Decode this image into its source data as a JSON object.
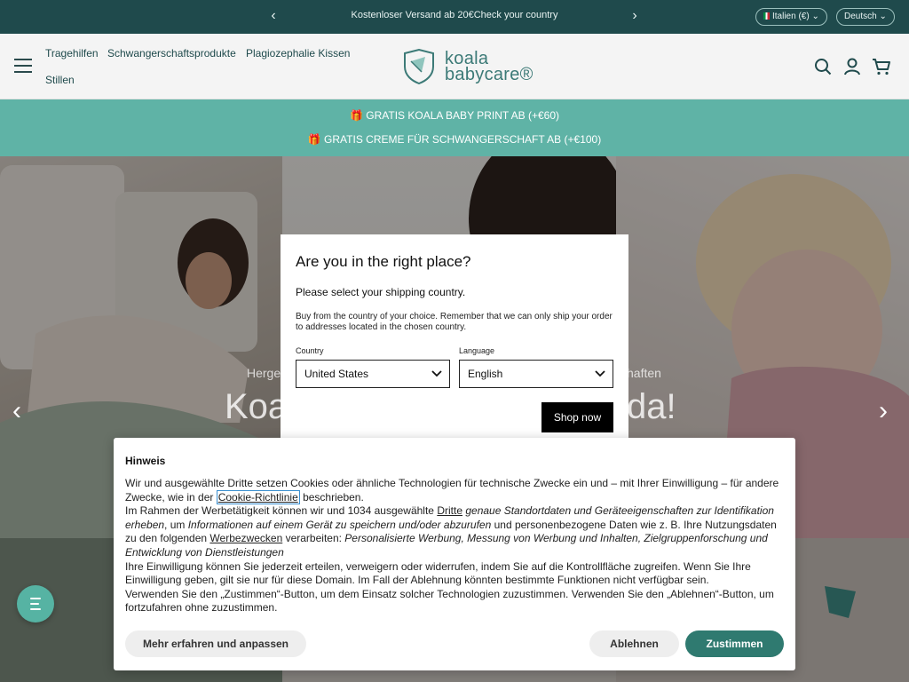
{
  "announcement": {
    "message": "Kostenloser Versand ab 20€Check your country",
    "region_pill": "Italien (€)",
    "language_pill": "Deutsch"
  },
  "header": {
    "nav": [
      "Tragehilfen",
      "Schwangerschaftsprodukte",
      "Plagiozephalie Kissen",
      "Stillen"
    ],
    "logo_line1": "koala",
    "logo_line2": "babycare®"
  },
  "promo": {
    "line1": "🎁 GRATIS KOALA BABY PRINT AB (+€60)",
    "line2": "🎁 GRATIS CREME FÜR SCHWANGERSCHAFT AB (+€100)"
  },
  "hero": {
    "subtitle_left": "Herge",
    "subtitle_right": "haften",
    "title_left": "Koa",
    "title_right": "da!"
  },
  "modal": {
    "title": "Are you in the right place?",
    "lead": "Please select your shipping country.",
    "description": "Buy from the country of your choice. Remember that we can only ship your order to addresses located in the chosen country.",
    "country_label": "Country",
    "country_value": "United States",
    "language_label": "Language",
    "language_value": "English",
    "cta": "Shop now"
  },
  "cookie": {
    "title": "Hinweis",
    "p1_a": "Wir und ausgewählte Dritte setzen Cookies oder ähnliche Technologien für technische Zwecke ein und – mit Ihrer Einwilligung – für andere Zwecke, wie in der ",
    "p1_link": "Cookie-Richtlinie",
    "p1_b": " beschrieben.",
    "p2_a": "Im Rahmen der Werbetätigkeit können wir und 1034 ausgewählte ",
    "p2_link1": "Dritte",
    "p2_b": " ",
    "p2_em1": "genaue Standortdaten und Geräteeigenschaften zur Identifikation erheben",
    "p2_c": ", um ",
    "p2_em2": "Informationen auf einem Gerät zu speichern und/oder abzurufen",
    "p2_d": " und personenbezogene Daten wie z. B. Ihre Nutzungsdaten zu den folgenden ",
    "p2_link2": "Werbezwecken",
    "p2_e": " verarbeiten: ",
    "p2_em3": "Personalisierte Werbung, Messung von Werbung und Inhalten, Zielgruppenforschung und Entwicklung von Dienstleistungen",
    "p3": "Ihre Einwilligung können Sie jederzeit erteilen, verweigern oder widerrufen, indem Sie auf die Kontrollfläche zugreifen. Wenn Sie Ihre Einwilligung geben, gilt sie nur für diese Domain. Im Fall der Ablehnung könnten bestimmte Funktionen nicht verfügbar sein.",
    "p4": "Verwenden Sie den „Zustimmen“-Button, um dem Einsatz solcher Technologien zuzustimmen. Verwenden Sie den „Ablehnen“-Button, um fortzufahren ohne zuzustimmen.",
    "btn_more": "Mehr erfahren und anpassen",
    "btn_reject": "Ablehnen",
    "btn_accept": "Zustimmen"
  },
  "colors": {
    "topbar": "#1f4a4c",
    "promo": "#5fb3a6",
    "accept_button": "#2f7a70",
    "chat": "#56b3a3"
  }
}
